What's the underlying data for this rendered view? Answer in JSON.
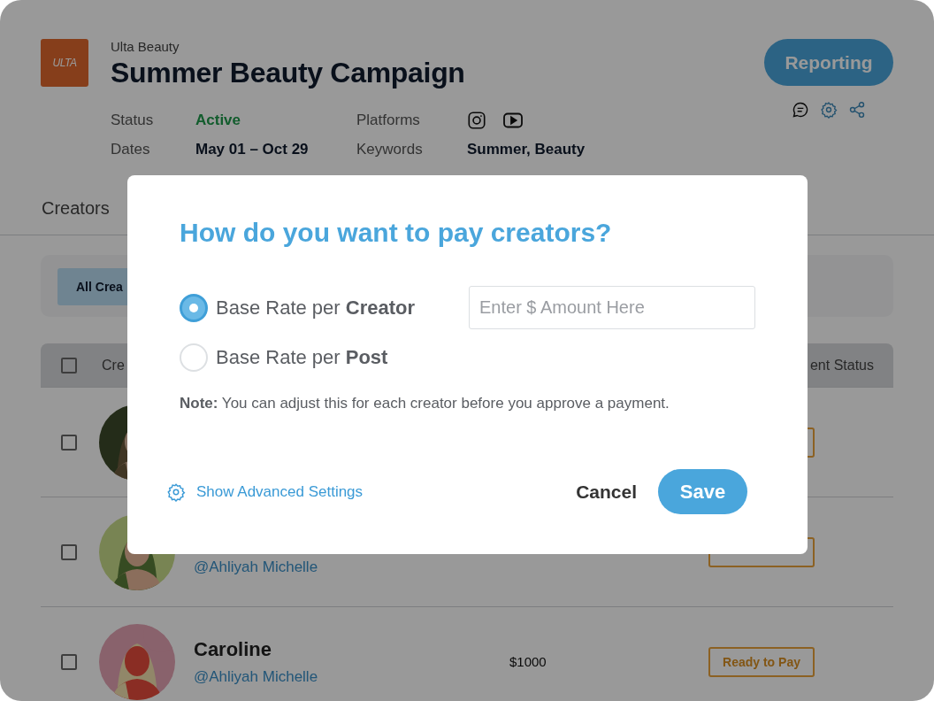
{
  "campaign": {
    "logo_text": "ULTA",
    "brand": "Ulta Beauty",
    "title": "Summer Beauty Campaign",
    "reporting_button": "Reporting",
    "fields": [
      {
        "label": "Status",
        "kind": "status",
        "value": "Active"
      },
      {
        "label": "Platforms",
        "kind": "platforms"
      },
      {
        "label": "Dates",
        "kind": "text",
        "value": "May 01 – Oct 29"
      },
      {
        "label": "Keywords",
        "kind": "text",
        "value": "Summer, Beauty"
      }
    ]
  },
  "section_tab": "Creators",
  "filters": [
    {
      "label": "All Crea",
      "selected": true
    }
  ],
  "table": {
    "columns": [
      "Cre",
      "ent Status"
    ],
    "header_checked": false,
    "rows": [
      {
        "checked": false
      },
      {
        "checked": false,
        "handle": "@Ahliyah Michelle"
      },
      {
        "checked": false,
        "name": "Caroline",
        "handle": "@Ahliyah Michelle",
        "amount": "$1000",
        "status": "Ready to Pay"
      }
    ]
  },
  "modal": {
    "title": "How do you want to pay creators?",
    "options": [
      {
        "label": "Base Rate per **Creator**",
        "selected": true
      },
      {
        "label": "Base Rate per **Post**",
        "selected": false
      }
    ],
    "amount_field": {
      "placeholder": "Enter $ Amount Here"
    },
    "note": "**Note:** You can adjust this for each creator before you approve a payment.",
    "advanced_link": "Show Advanced Settings",
    "cancel_button": "Cancel",
    "save_button": "Save"
  }
}
